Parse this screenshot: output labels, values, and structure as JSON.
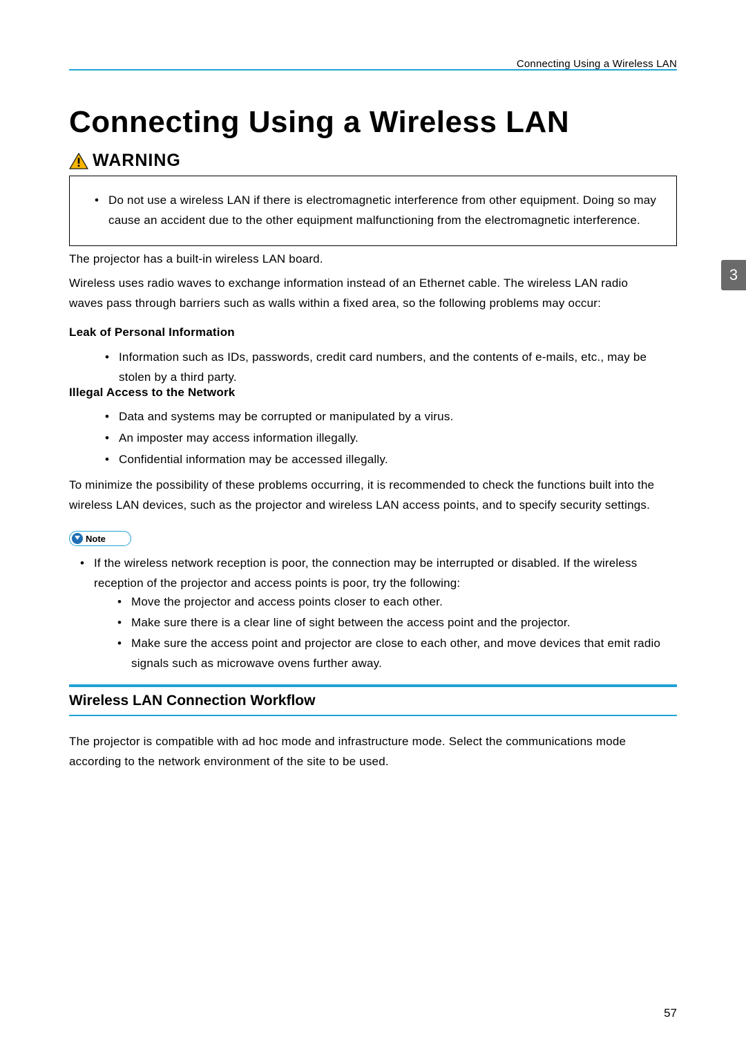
{
  "running_head": "Connecting Using a Wireless LAN",
  "main_title": "Connecting Using a Wireless LAN",
  "warning_label": "WARNING",
  "warning_body": "Do not use a wireless LAN if there is electromagnetic interference from other equipment. Doing so may cause an accident due to the other equipment malfunctioning from the electromagnetic interference.",
  "intro_p1": "The projector has a built-in wireless LAN board.",
  "intro_p2": "Wireless uses radio waves to exchange information instead of an Ethernet cable. The wireless LAN radio waves pass through barriers such as walls within a fixed area, so the following problems may occur:",
  "leak_heading": "Leak of Personal Information",
  "leak_item": "Information such as IDs, passwords, credit card numbers, and the contents of e-mails, etc., may be stolen by a third party.",
  "illegal_heading": "Illegal Access to the Network",
  "illegal_items": [
    "Data and systems may be corrupted or manipulated by a virus.",
    "An imposter may access information illegally.",
    "Confidential information may be accessed illegally."
  ],
  "minimize_p": "To minimize the possibility of these problems occurring, it is recommended to check the functions built into the wireless LAN devices, such as the projector and wireless LAN access points, and to specify security settings.",
  "note_label": "Note",
  "note_intro": "If the wireless network reception is poor, the connection may be interrupted or disabled. If the wireless reception of the projector and access points is poor, try the following:",
  "note_subitems": [
    "Move the projector and access points closer to each other.",
    "Make sure there is a clear line of sight between the access point and the projector.",
    "Make sure the access point and projector are close to each other, and move devices that emit radio signals such as microwave ovens further away."
  ],
  "section_heading": "Wireless LAN Connection Workflow",
  "section_body": "The projector is compatible with ad hoc mode and infrastructure mode. Select the communications mode according to the network environment of the site to be used.",
  "chapter_tab": "3",
  "page_number": "57"
}
